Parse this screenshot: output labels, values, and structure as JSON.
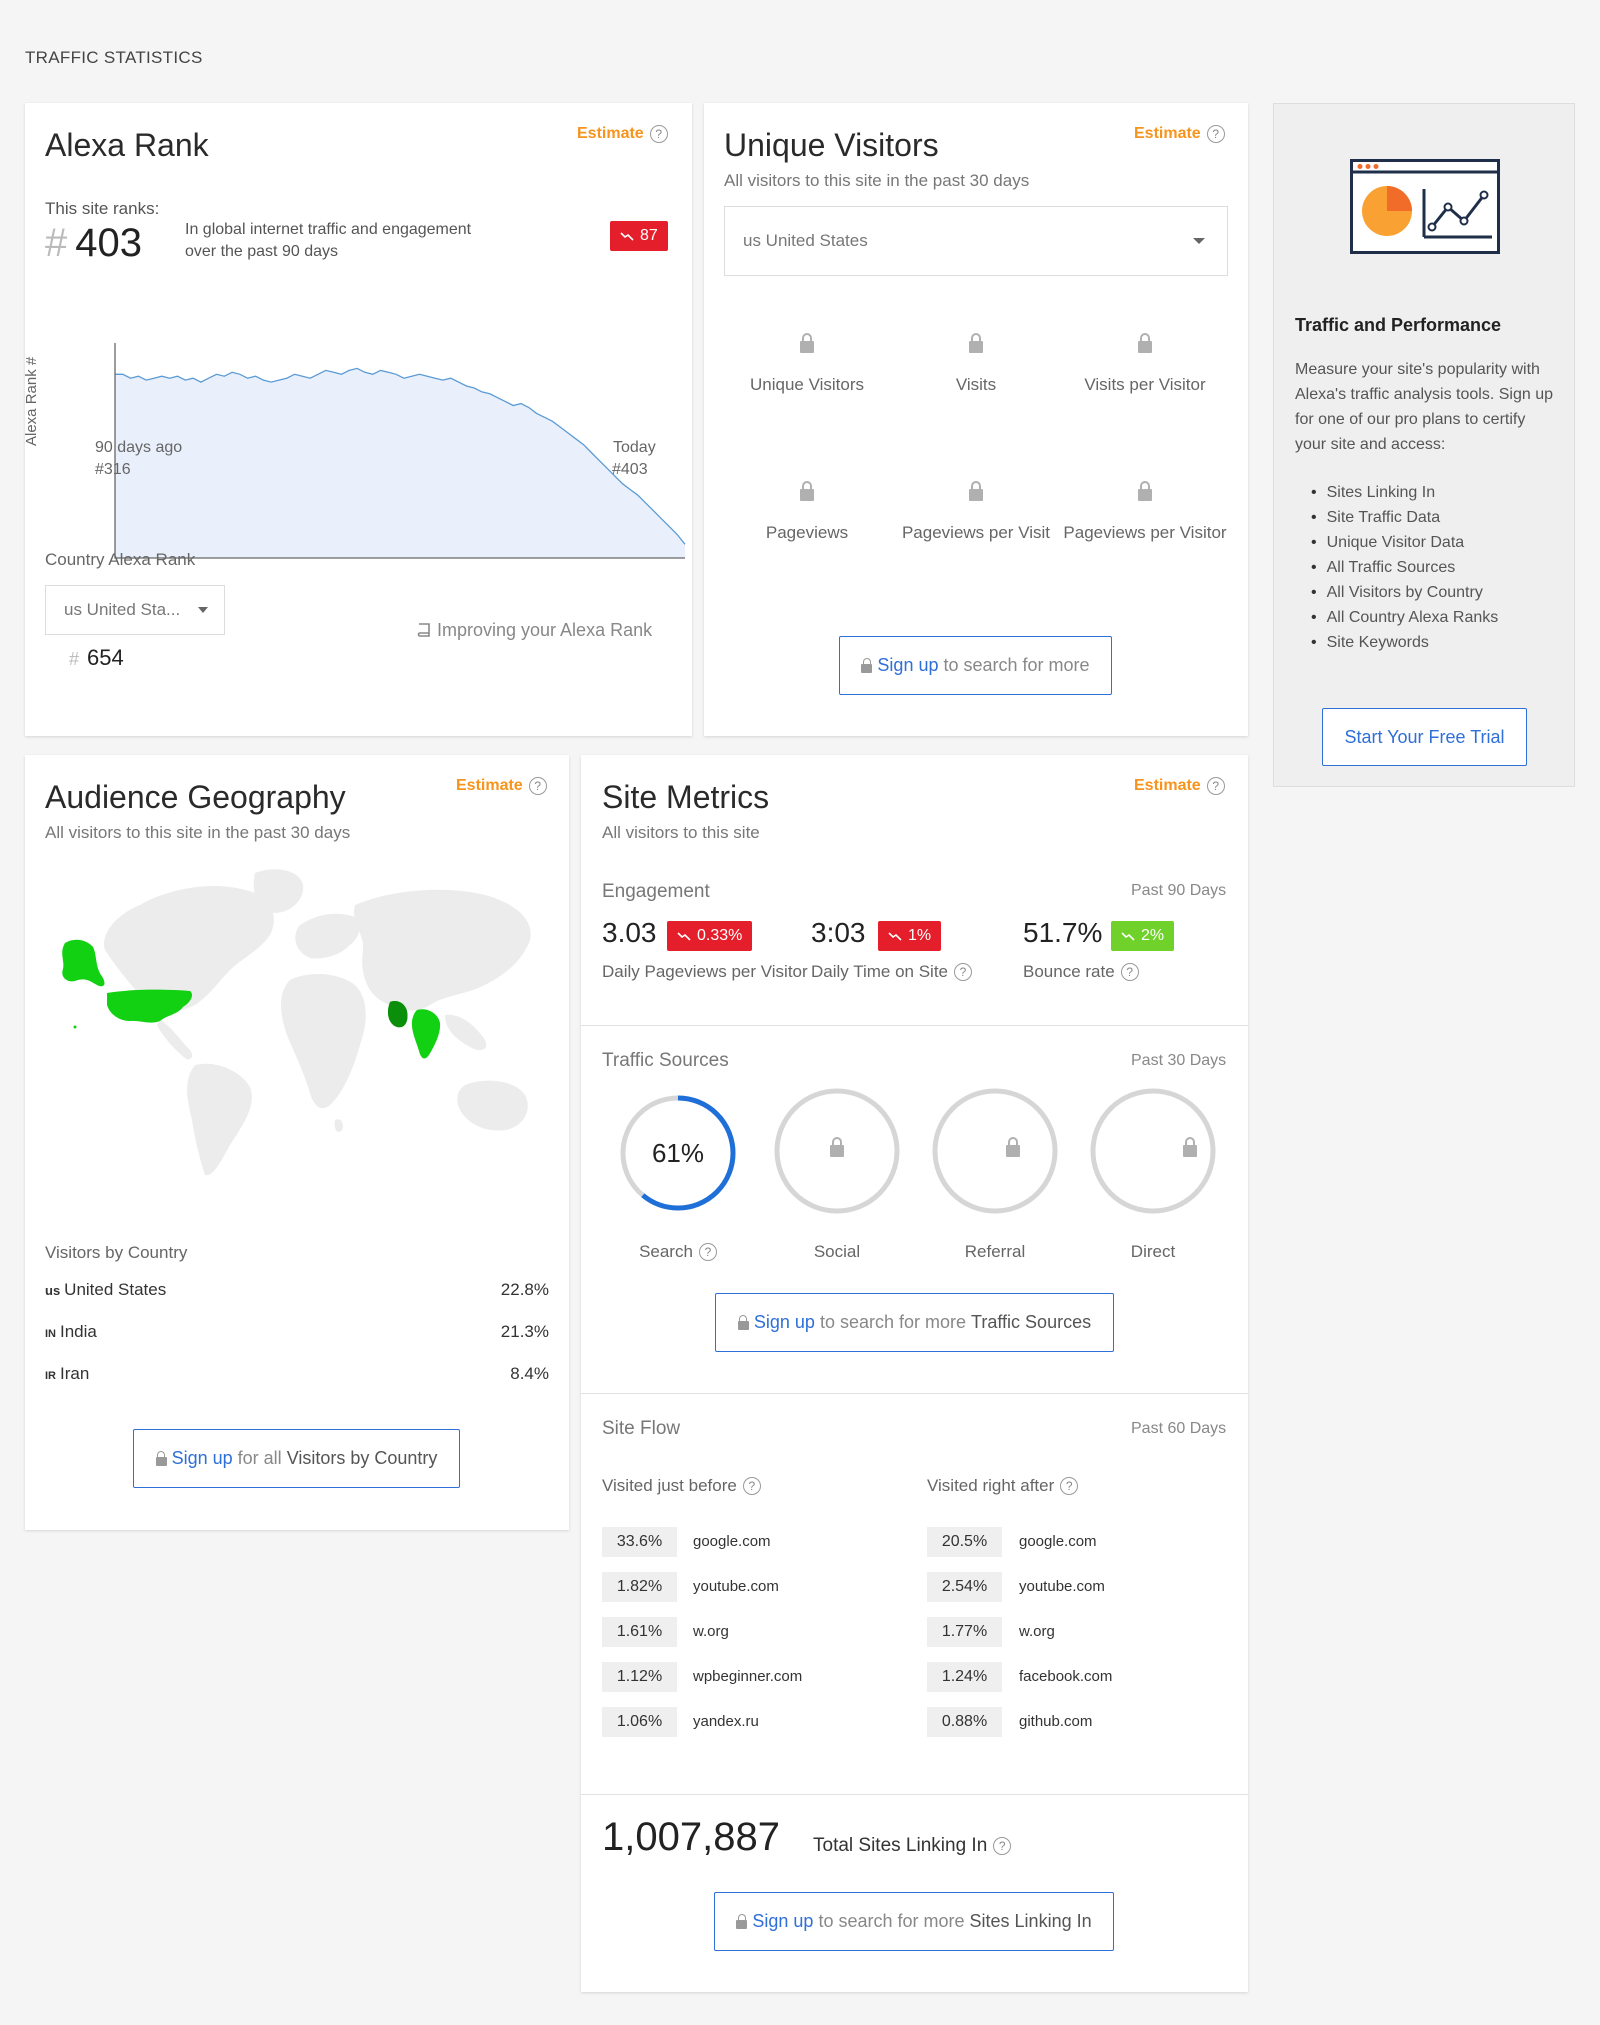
{
  "page": {
    "section_title": "TRAFFIC STATISTICS"
  },
  "estimate_label": "Estimate",
  "help_glyph": "?",
  "alexa_rank": {
    "title": "Alexa Rank",
    "ranks_label": "This site ranks:",
    "hash": "#",
    "rank": "403",
    "description": "In global internet traffic and engagement over the past 90 days",
    "change_badge": "87",
    "chart_data": {
      "type": "area",
      "ylabel": "Alexa Rank #",
      "x_start_label": "90 days ago",
      "x_end_label": "Today",
      "start_value_label": "#316",
      "end_value_label": "#403",
      "values": [
        316,
        316,
        318,
        317,
        319,
        318,
        317,
        318,
        317,
        319,
        318,
        320,
        318,
        316,
        317,
        315,
        316,
        318,
        317,
        319,
        320,
        319,
        318,
        316,
        317,
        318,
        316,
        314,
        315,
        316,
        314,
        313,
        315,
        316,
        314,
        315,
        316,
        318,
        317,
        316,
        317,
        318,
        319,
        318,
        320,
        322,
        323,
        325,
        326,
        328,
        330,
        332,
        331,
        333,
        336,
        338,
        340,
        343,
        346,
        349,
        352,
        356,
        360,
        364,
        368,
        372,
        375,
        378,
        382,
        386,
        390,
        394,
        398,
        403
      ],
      "color": "#5b9bd5",
      "fill": "#e9f0fb"
    },
    "country_label": "Country Alexa Rank",
    "country_select": "us United Sta...",
    "country_rank": "654",
    "improve_link": "Improving your Alexa Rank"
  },
  "unique_visitors": {
    "title": "Unique Visitors",
    "subtitle": "All visitors to this site in the past 30 days",
    "country_select": "us United States",
    "locked_metrics": [
      "Unique Visitors",
      "Visits",
      "Visits per Visitor",
      "Pageviews",
      "Pageviews per Visit",
      "Pageviews per Visitor"
    ],
    "signup_link": "Sign up",
    "signup_rest": "to search for more"
  },
  "sidebar_promo": {
    "title": "Traffic and Performance",
    "description": "Measure your site's popularity with Alexa's traffic analysis tools. Sign up for one of our pro plans to certify your site and access:",
    "features": [
      "Sites Linking In",
      "Site Traffic Data",
      "Unique Visitor Data",
      "All Traffic Sources",
      "All Visitors by Country",
      "All Country Alexa Ranks",
      "Site Keywords"
    ],
    "cta": "Start Your Free Trial"
  },
  "audience_geography": {
    "title": "Audience Geography",
    "subtitle": "All visitors to this site in the past 30 days",
    "visitors_label": "Visitors by Country",
    "countries": [
      {
        "code": "us",
        "name": "United States",
        "pct": "22.8%"
      },
      {
        "code": "IN",
        "name": "India",
        "pct": "21.3%"
      },
      {
        "code": "IR",
        "name": "Iran",
        "pct": "8.4%"
      }
    ],
    "signup_link": "Sign up",
    "signup_mid": "for all",
    "signup_end": "Visitors by Country",
    "highlight_color": "#12d012"
  },
  "site_metrics": {
    "title": "Site Metrics",
    "subtitle": "All visitors to this site",
    "engagement": {
      "label": "Engagement",
      "period": "Past 90 Days",
      "metrics": [
        {
          "value": "3.03",
          "change": "0.33%",
          "label": "Daily Pageviews per Visitor",
          "dir": "down"
        },
        {
          "value": "3:03",
          "change": "1%",
          "label": "Daily Time on Site",
          "dir": "down"
        },
        {
          "value": "51.7%",
          "change": "2%",
          "label": "Bounce rate",
          "dir": "down-good"
        }
      ]
    },
    "traffic_sources": {
      "label": "Traffic Sources",
      "period": "Past 30 Days",
      "search_pct": "61%",
      "search_value": 61,
      "sources": [
        "Search",
        "Social",
        "Referral",
        "Direct"
      ],
      "signup_link": "Sign up",
      "signup_mid": "to search for more",
      "signup_end": "Traffic Sources"
    },
    "site_flow": {
      "label": "Site Flow",
      "period": "Past 60 Days",
      "before_label": "Visited just before",
      "after_label": "Visited right after",
      "before": [
        {
          "pct": "33.6%",
          "site": "google.com"
        },
        {
          "pct": "1.82%",
          "site": "youtube.com"
        },
        {
          "pct": "1.61%",
          "site": "w.org"
        },
        {
          "pct": "1.12%",
          "site": "wpbeginner.com"
        },
        {
          "pct": "1.06%",
          "site": "yandex.ru"
        }
      ],
      "after": [
        {
          "pct": "20.5%",
          "site": "google.com"
        },
        {
          "pct": "2.54%",
          "site": "youtube.com"
        },
        {
          "pct": "1.77%",
          "site": "w.org"
        },
        {
          "pct": "1.24%",
          "site": "facebook.com"
        },
        {
          "pct": "0.88%",
          "site": "github.com"
        }
      ]
    },
    "linking": {
      "count": "1,007,887",
      "label": "Total Sites Linking In",
      "signup_link": "Sign up",
      "signup_mid": "to search for more",
      "signup_end": "Sites Linking In"
    }
  },
  "colors": {
    "accent_blue": "#2e6fd8",
    "estimate_orange": "#f7941d",
    "down_red": "#e41e2b",
    "good_green": "#6fd12a"
  }
}
